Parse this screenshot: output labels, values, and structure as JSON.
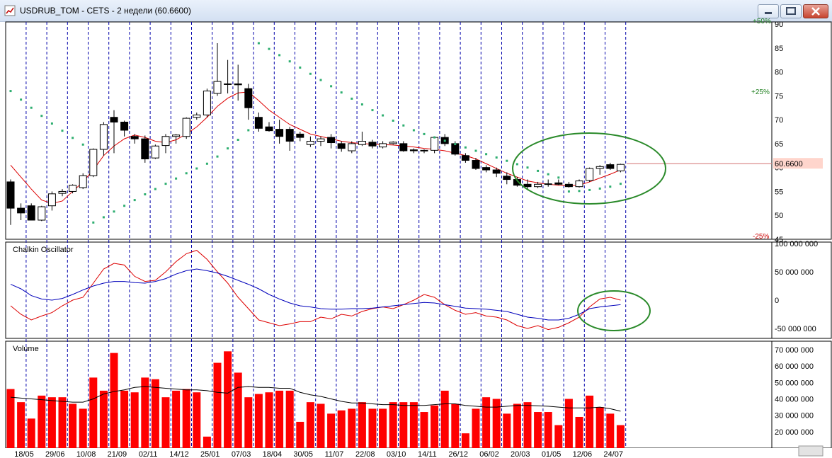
{
  "window": {
    "title": "USDRUB_TOM - CETS - 2 недели (60.6600)",
    "icons": [
      "chart-app-icon",
      "minimize-icon",
      "maximize-icon",
      "close-icon"
    ]
  },
  "colors": {
    "up_candle": "#ffffff",
    "down_candle": "#000000",
    "ma": "#dd0000",
    "sar": "#2eae70",
    "chaikin_fast": "#dd0000",
    "chaikin_slow": "#0000bb",
    "volume_bar": "#ff0000",
    "volume_ma": "#000000",
    "annotation": "#2a8a2a",
    "grid_vertical": "#0000aa"
  },
  "chart_data": [
    {
      "type": "candlestick",
      "panel": "price",
      "title": "",
      "y_ticks": [
        "90",
        "85",
        "80",
        "75",
        "70",
        "65",
        "60",
        "55",
        "50",
        "45"
      ],
      "ylim": [
        45,
        90
      ],
      "percent_labels": [
        "+50%",
        "+25%",
        "-25%"
      ],
      "last_price_label": "60.6600",
      "x_labels": [
        "18/05",
        "29/06",
        "10/08",
        "21/09",
        "02/11",
        "14/12",
        "25/01",
        "07/03",
        "18/04",
        "30/05",
        "11/07",
        "22/08",
        "03/10",
        "14/11",
        "26/12",
        "06/02",
        "20/03",
        "01/05",
        "12/06",
        "24/07"
      ],
      "candles": [
        [
          57,
          57.5,
          48,
          51.5
        ],
        [
          51.5,
          52.5,
          49,
          50.5
        ],
        [
          52,
          52.5,
          49,
          49
        ],
        [
          49,
          52,
          48.8,
          51.8
        ],
        [
          52,
          55,
          51,
          54.5
        ],
        [
          54.6,
          55.5,
          54,
          55
        ],
        [
          55,
          56.5,
          54.6,
          56.3
        ],
        [
          55.8,
          58.8,
          55.5,
          58.3
        ],
        [
          58.3,
          64,
          58,
          63.8
        ],
        [
          63.8,
          69.5,
          62.5,
          69
        ],
        [
          70.5,
          72,
          63,
          69.5
        ],
        [
          69.5,
          69.8,
          66.5,
          67.8
        ],
        [
          66.5,
          67,
          65,
          66
        ],
        [
          66,
          66.7,
          61,
          61.8
        ],
        [
          62,
          64.8,
          61.8,
          64.5
        ],
        [
          64.6,
          67,
          63,
          66.5
        ],
        [
          66.5,
          67,
          65,
          66.8
        ],
        [
          66.5,
          70.5,
          66,
          70.3
        ],
        [
          70.5,
          71.5,
          70,
          71
        ],
        [
          71,
          76.5,
          70.5,
          76
        ],
        [
          75.5,
          86,
          75,
          78
        ],
        [
          77.5,
          82.5,
          75.5,
          77.5
        ],
        [
          77.5,
          81.5,
          74,
          77.3
        ],
        [
          76.5,
          77.5,
          70,
          72.5
        ],
        [
          70.5,
          71.5,
          67.5,
          68.2
        ],
        [
          68.5,
          69.5,
          67.5,
          67.7
        ],
        [
          68,
          70,
          65,
          66.5
        ],
        [
          68,
          68.5,
          63.5,
          65.5
        ],
        [
          67,
          67.5,
          65.5,
          66.3
        ],
        [
          64.8,
          66.5,
          64.3,
          65.5
        ],
        [
          65.5,
          66.5,
          64.5,
          66
        ],
        [
          66.3,
          67,
          64,
          65.2
        ],
        [
          65,
          65.5,
          63.3,
          64
        ],
        [
          63.5,
          65.5,
          63,
          65
        ],
        [
          64.8,
          67.5,
          64.5,
          65.5
        ],
        [
          65.3,
          65.8,
          64,
          64.5
        ],
        [
          64.3,
          65.5,
          64,
          65
        ],
        [
          65,
          65.5,
          64.8,
          65.3
        ],
        [
          65,
          65.5,
          63.3,
          63.5
        ],
        [
          63.7,
          64,
          63,
          63.5
        ],
        [
          63.5,
          63.8,
          63,
          63.6
        ],
        [
          63.6,
          66.5,
          63,
          66.3
        ],
        [
          66.3,
          67,
          64.5,
          65
        ],
        [
          65,
          65.5,
          62.5,
          62.8
        ],
        [
          62.5,
          63,
          61,
          61.5
        ],
        [
          61.5,
          62,
          59.5,
          59.8
        ],
        [
          60,
          60.5,
          59,
          59.5
        ],
        [
          59.5,
          60,
          58,
          58.8
        ],
        [
          58.2,
          59,
          56.5,
          57.5
        ],
        [
          57.5,
          58,
          56,
          56.3
        ],
        [
          56.5,
          57.5,
          55.5,
          56
        ],
        [
          56,
          57,
          55.7,
          56.5
        ],
        [
          56.5,
          57.5,
          56,
          56.6
        ],
        [
          56.8,
          57.5,
          56.3,
          56.5
        ],
        [
          56.5,
          57,
          55.8,
          56
        ],
        [
          56,
          57.5,
          55.8,
          57.2
        ],
        [
          57.3,
          60,
          57,
          59.8
        ],
        [
          59.8,
          60.5,
          58.5,
          60.2
        ],
        [
          60.6,
          61,
          59.5,
          59.8
        ],
        [
          59.3,
          60.8,
          59,
          60.66
        ]
      ],
      "ma": [
        60.5,
        58,
        55.5,
        53.2,
        52.5,
        53,
        55,
        57,
        59.5,
        62.5,
        64.5,
        66,
        66.8,
        66.3,
        65.5,
        65.2,
        65.8,
        67,
        68.5,
        70.5,
        72.8,
        74.5,
        75.6,
        75.8,
        74,
        72,
        70.5,
        69,
        68,
        67,
        66.5,
        66,
        65.5,
        65.2,
        65,
        64.9,
        64.8,
        64.7,
        64.5,
        64.3,
        64,
        63.8,
        63.5,
        63,
        62.5,
        61.8,
        60.8,
        59.8,
        58.8,
        58,
        57.2,
        56.8,
        56.5,
        56.3,
        56.2,
        56.3,
        57,
        57.8,
        58.6,
        59.5
      ],
      "sar": [
        76,
        74.2,
        72.5,
        70.8,
        69.2,
        67.7,
        66.2,
        64.8,
        48.5,
        49.6,
        50.8,
        52,
        53.2,
        54.4,
        55.5,
        56.6,
        57.7,
        58.8,
        59.8,
        60.8,
        62.3,
        64,
        65.8,
        67.8,
        86,
        84.8,
        83.5,
        82.2,
        80.9,
        79.6,
        78.3,
        77,
        75.7,
        74.4,
        73.2,
        72,
        70.9,
        69.8,
        68.8,
        67.8,
        67,
        66.3,
        65.6,
        64.9,
        64.2,
        63.5,
        62.8,
        62.1,
        61.4,
        60.7,
        60,
        59.3,
        58.6,
        57.9,
        55,
        55.1,
        55.3,
        55.6,
        56,
        56.6
      ]
    },
    {
      "type": "line",
      "panel": "chaikin",
      "title": "Chalkin Oscillator",
      "y_ticks": [
        "100 000 000",
        "50 000 000",
        "0",
        "-50 000 000"
      ],
      "ylim": [
        -65000000,
        100000000
      ],
      "series": [
        {
          "values": [
            -10000000,
            -25000000,
            -35000000,
            -28000000,
            -22000000,
            -10000000,
            0,
            5000000,
            30000000,
            55000000,
            65000000,
            62000000,
            42000000,
            33000000,
            35000000,
            50000000,
            68000000,
            82000000,
            88000000,
            72000000,
            50000000,
            30000000,
            5000000,
            -15000000,
            -35000000,
            -40000000,
            -45000000,
            -42000000,
            -38000000,
            -38000000,
            -30000000,
            -33000000,
            -25000000,
            -28000000,
            -20000000,
            -15000000,
            -12000000,
            -15000000,
            -8000000,
            0,
            10000000,
            5000000,
            -8000000,
            -18000000,
            -25000000,
            -22000000,
            -28000000,
            -30000000,
            -35000000,
            -45000000,
            -50000000,
            -45000000,
            -52000000,
            -48000000,
            -40000000,
            -30000000,
            -12000000,
            2000000,
            5000000,
            0
          ]
        },
        {
          "values": [
            28000000,
            20000000,
            8000000,
            2000000,
            0,
            3000000,
            10000000,
            18000000,
            25000000,
            30000000,
            33000000,
            33000000,
            31000000,
            30000000,
            33000000,
            38000000,
            46000000,
            52000000,
            55000000,
            52000000,
            48000000,
            42000000,
            35000000,
            28000000,
            20000000,
            10000000,
            2000000,
            -5000000,
            -10000000,
            -12000000,
            -15000000,
            -16000000,
            -16000000,
            -15000000,
            -15000000,
            -14000000,
            -12000000,
            -10000000,
            -8000000,
            -6000000,
            -4000000,
            -5000000,
            -8000000,
            -11000000,
            -14000000,
            -15000000,
            -16000000,
            -18000000,
            -20000000,
            -25000000,
            -30000000,
            -32000000,
            -35000000,
            -35000000,
            -32000000,
            -25000000,
            -15000000,
            -12000000,
            -10000000,
            -8000000
          ]
        }
      ]
    },
    {
      "type": "bar",
      "panel": "volume",
      "title": "Volume",
      "y_ticks": [
        "70 000 000",
        "60 000 000",
        "50 000 000",
        "40 000 000",
        "30 000 000",
        "20 000 000"
      ],
      "ylim": [
        10000000,
        75000000
      ],
      "values": [
        46000000,
        38000000,
        28000000,
        42000000,
        41000000,
        41000000,
        37000000,
        34000000,
        53000000,
        45000000,
        68000000,
        45000000,
        44000000,
        53000000,
        52000000,
        41000000,
        45000000,
        46000000,
        44000000,
        17000000,
        62000000,
        69000000,
        56000000,
        41000000,
        43000000,
        44000000,
        45000000,
        45000000,
        26000000,
        38000000,
        37000000,
        31000000,
        33000000,
        34000000,
        38000000,
        34000000,
        34000000,
        38000000,
        38000000,
        38000000,
        32000000,
        36000000,
        45000000,
        37000000,
        19000000,
        34000000,
        41000000,
        40000000,
        31000000,
        37000000,
        38000000,
        32000000,
        32000000,
        24000000,
        40000000,
        29000000,
        42000000,
        35000000,
        31000000,
        24000000
      ],
      "ma_values": [
        41000000,
        40500000,
        40000000,
        39500000,
        39000000,
        38500000,
        38000000,
        38000000,
        40000000,
        43000000,
        44500000,
        45500000,
        47000000,
        47500000,
        47000000,
        46500000,
        46000000,
        45500000,
        45500000,
        45000000,
        44000000,
        43500000,
        47000000,
        47500000,
        47000000,
        47000000,
        46500000,
        46500000,
        44000000,
        42500000,
        41500000,
        40000000,
        38500000,
        37500000,
        37500000,
        37000000,
        36500000,
        36500000,
        36000000,
        36000000,
        36000000,
        36500000,
        37000000,
        37000000,
        36000000,
        35500000,
        35000000,
        35000000,
        35500000,
        36000000,
        36000000,
        35800000,
        35500000,
        35000000,
        34500000,
        34500000,
        34500000,
        35000000,
        34000000,
        32500000
      ]
    }
  ]
}
